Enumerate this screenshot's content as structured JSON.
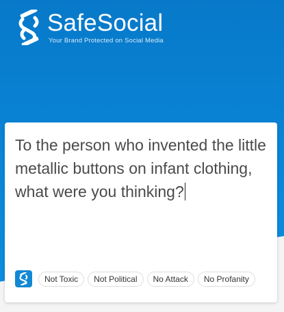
{
  "brand": {
    "name": "SafeSocial",
    "tagline": "Your Brand Protected on Social Media"
  },
  "message": {
    "text": "To the person who invented the little metallic buttons on infant clothing, what were you thinking?"
  },
  "tags": [
    {
      "label": "Not Toxic"
    },
    {
      "label": "Not Political"
    },
    {
      "label": "No Attack"
    },
    {
      "label": "No Profanity"
    }
  ],
  "icons": {
    "logo": "safesocial-logo-icon",
    "badge": "safesocial-badge-icon"
  },
  "colors": {
    "hero_blue": "#0a86d8",
    "badge_blue": "#1188d4",
    "text_gray": "#4a4a4a"
  }
}
